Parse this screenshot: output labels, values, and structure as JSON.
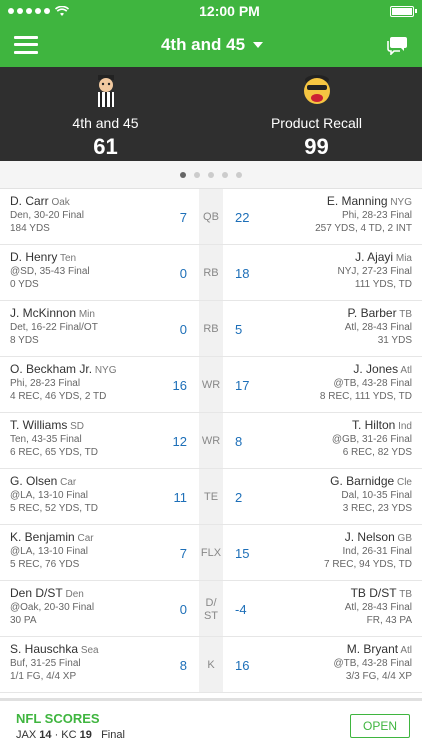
{
  "status": {
    "time": "12:00 PM"
  },
  "nav": {
    "title": "4th and 45"
  },
  "home": {
    "name": "4th and 45",
    "score": "61"
  },
  "away": {
    "name": "Product Recall",
    "score": "99"
  },
  "pager": {
    "count": 5,
    "active": 0
  },
  "rows": [
    {
      "pos": "QB",
      "left": {
        "name": "D. Carr",
        "team": "Oak",
        "game": "Den, 30-20 Final",
        "stats": "184 YDS",
        "points": "7"
      },
      "right": {
        "name": "E. Manning",
        "team": "NYG",
        "game": "Phi, 28-23 Final",
        "stats": "257 YDS, 4 TD, 2 INT",
        "points": "22"
      }
    },
    {
      "pos": "RB",
      "left": {
        "name": "D. Henry",
        "team": "Ten",
        "game": "@SD, 35-43 Final",
        "stats": "0 YDS",
        "points": "0"
      },
      "right": {
        "name": "J. Ajayi",
        "team": "Mia",
        "game": "NYJ, 27-23 Final",
        "stats": "111 YDS, TD",
        "points": "18"
      }
    },
    {
      "pos": "RB",
      "left": {
        "name": "J. McKinnon",
        "team": "Min",
        "game": "Det, 16-22 Final/OT",
        "stats": "8 YDS",
        "points": "0"
      },
      "right": {
        "name": "P. Barber",
        "team": "TB",
        "game": "Atl, 28-43 Final",
        "stats": "31 YDS",
        "points": "5"
      }
    },
    {
      "pos": "WR",
      "left": {
        "name": "O. Beckham Jr.",
        "team": "NYG",
        "game": "Phi, 28-23 Final",
        "stats": "4 REC, 46 YDS, 2 TD",
        "points": "16"
      },
      "right": {
        "name": "J. Jones",
        "team": "Atl",
        "game": "@TB, 43-28 Final",
        "stats": "8 REC, 111 YDS, TD",
        "points": "17"
      }
    },
    {
      "pos": "WR",
      "left": {
        "name": "T. Williams",
        "team": "SD",
        "game": "Ten, 43-35 Final",
        "stats": "6 REC, 65 YDS, TD",
        "points": "12"
      },
      "right": {
        "name": "T. Hilton",
        "team": "Ind",
        "game": "@GB, 31-26 Final",
        "stats": "6 REC, 82 YDS",
        "points": "8"
      }
    },
    {
      "pos": "TE",
      "left": {
        "name": "G. Olsen",
        "team": "Car",
        "game": "@LA, 13-10 Final",
        "stats": "5 REC, 52 YDS, TD",
        "points": "11"
      },
      "right": {
        "name": "G. Barnidge",
        "team": "Cle",
        "game": "Dal, 10-35 Final",
        "stats": "3 REC, 23 YDS",
        "points": "2"
      }
    },
    {
      "pos": "FLX",
      "left": {
        "name": "K. Benjamin",
        "team": "Car",
        "game": "@LA, 13-10 Final",
        "stats": "5 REC, 76 YDS",
        "points": "7"
      },
      "right": {
        "name": "J. Nelson",
        "team": "GB",
        "game": "Ind, 26-31 Final",
        "stats": "7 REC, 94 YDS, TD",
        "points": "15"
      }
    },
    {
      "pos": "D/ ST",
      "left": {
        "name": "Den D/ST",
        "team": "Den",
        "game": "@Oak, 20-30 Final",
        "stats": "30 PA",
        "points": "0"
      },
      "right": {
        "name": "TB D/ST",
        "team": "TB",
        "game": "Atl, 28-43 Final",
        "stats": "FR, 43 PA",
        "points": "-4"
      }
    },
    {
      "pos": "K",
      "left": {
        "name": "S. Hauschka",
        "team": "Sea",
        "game": "Buf, 31-25 Final",
        "stats": "1/1 FG, 4/4 XP",
        "points": "8"
      },
      "right": {
        "name": "M. Bryant",
        "team": "Atl",
        "game": "@TB, 43-28 Final",
        "stats": "3/3 FG, 4/4 XP",
        "points": "16"
      }
    }
  ],
  "footer": {
    "title": "NFL SCORES",
    "away_team": "JAX",
    "away_score": "14",
    "separator": "·",
    "home_team": "KC",
    "home_score": "19",
    "status": "Final",
    "open_label": "OPEN"
  },
  "colors": {
    "brand": "#3fb53f",
    "points": "#1d6fb8",
    "scoreboard": "#2f2f2f"
  }
}
